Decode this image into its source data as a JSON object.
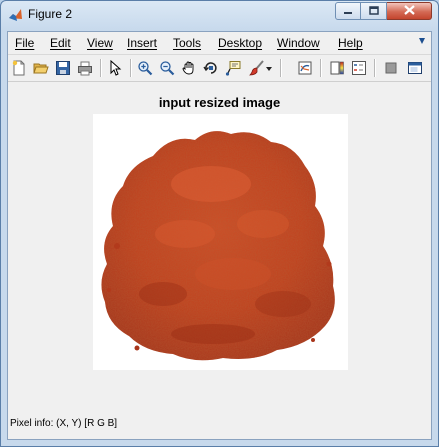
{
  "window": {
    "title": "Figure 2",
    "icon": "matlab-figure-icon",
    "controls": [
      "minimize-icon",
      "maximize-icon",
      "close-icon"
    ]
  },
  "menubar": {
    "items": [
      {
        "label": "File"
      },
      {
        "label": "Edit"
      },
      {
        "label": "View"
      },
      {
        "label": "Insert"
      },
      {
        "label": "Tools"
      },
      {
        "label": "Desktop"
      },
      {
        "label": "Window"
      },
      {
        "label": "Help"
      }
    ]
  },
  "toolbar": {
    "icons": [
      "new-figure-icon",
      "open-file-icon",
      "save-figure-icon",
      "print-figure-icon",
      "edit-plot-icon",
      "zoom-in-icon",
      "zoom-out-icon",
      "pan-icon",
      "rotate-3d-icon",
      "data-cursor-icon",
      "brush-icon",
      "brush-dropdown-icon",
      "link-plot-icon",
      "insert-colorbar-icon",
      "insert-legend-icon",
      "hide-plot-tools-icon",
      "show-plot-tools-icon"
    ]
  },
  "axes": {
    "title": "input resized image",
    "image": "orange-powder-pile"
  },
  "status": {
    "pixel_info": "Pixel info: (X, Y)  [R G B]"
  },
  "colors": {
    "powder_dark": "#a8341a",
    "powder_mid": "#cc4a25",
    "powder_light": "#e06a3c",
    "client_bg": "#f0f0f0",
    "titlebar_bg": "#c7d9ec"
  }
}
